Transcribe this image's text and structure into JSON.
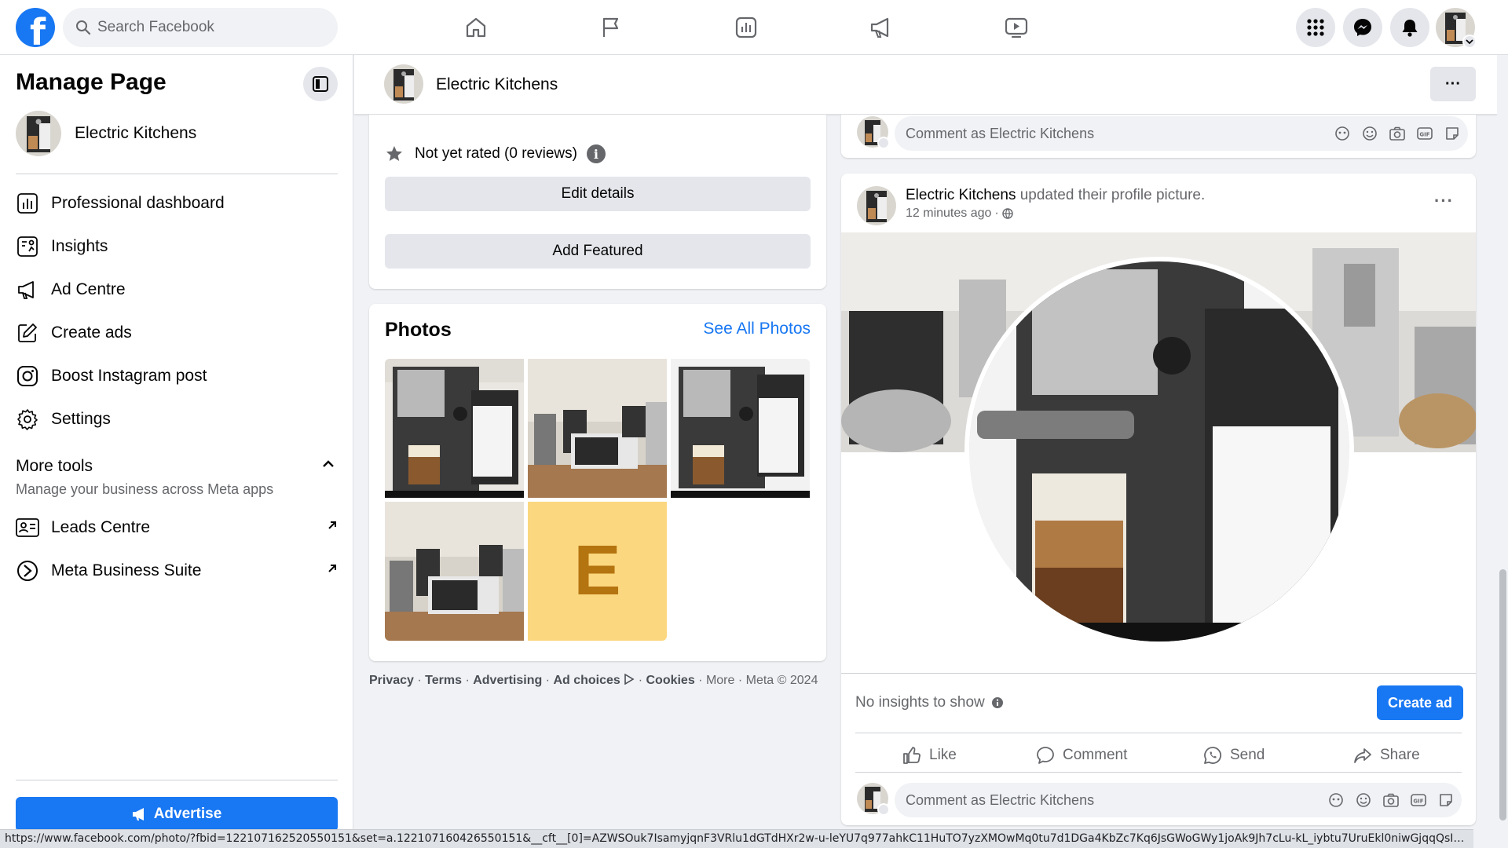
{
  "topbar": {
    "search_placeholder": "Search Facebook",
    "nav_icons": [
      "home-icon",
      "flag-icon",
      "insights-icon",
      "megaphone-icon",
      "video-icon"
    ],
    "right_icons": [
      "menu-grid-icon",
      "messenger-icon",
      "bell-icon",
      "profile-avatar"
    ]
  },
  "sidebar": {
    "title": "Manage Page",
    "page_name": "Electric Kitchens",
    "items": [
      {
        "label": "Professional dashboard",
        "icon": "dashboard-icon"
      },
      {
        "label": "Insights",
        "icon": "insights-icon"
      },
      {
        "label": "Ad Centre",
        "icon": "megaphone-icon"
      },
      {
        "label": "Create ads",
        "icon": "pencil-icon"
      },
      {
        "label": "Boost Instagram post",
        "icon": "instagram-icon"
      },
      {
        "label": "Settings",
        "icon": "gear-icon"
      }
    ],
    "more_tools": {
      "title": "More tools",
      "subtitle": "Manage your business across Meta apps",
      "items": [
        {
          "label": "Leads Centre",
          "icon": "contact-card-icon"
        },
        {
          "label": "Meta Business Suite",
          "icon": "meta-business-icon"
        }
      ]
    },
    "advertise_label": "Advertise"
  },
  "page_header": {
    "name": "Electric Kitchens",
    "more": "···"
  },
  "about_card": {
    "rating_text": "Not yet rated (0 reviews)",
    "info": "i",
    "edit_details": "Edit details",
    "add_featured": "Add Featured"
  },
  "photos_card": {
    "title": "Photos",
    "see_all": "See All Photos",
    "letter_tile": "E"
  },
  "footer": {
    "links": [
      "Privacy",
      "Terms",
      "Advertising",
      "Ad choices",
      "Cookies"
    ],
    "more": "More",
    "copyright": "Meta © 2024"
  },
  "comment_placeholder": "Comment as Electric Kitchens",
  "post": {
    "author": "Electric Kitchens",
    "action_text": "updated their profile picture.",
    "time": "12 minutes ago",
    "dots": "···",
    "insights_text": "No insights to show",
    "create_ad": "Create ad",
    "actions": [
      "Like",
      "Comment",
      "Send",
      "Share"
    ]
  },
  "status_url": "https://www.facebook.com/photo/?fbid=122107162520550151&set=a.122107160426550151&__cft__[0]=AZWSOuk7IsamyjqnF3VRlu1dGTdHXr2w-u-leYU7q977ahkC11HuTO7yzXMOwMq0tu7d1DGa4KbZc7Kq6JsGWoGWy1joAk9Jh7cLu-kL_iybtu7UruEkl0niwGjqqQsIrY4BBvqXnrWB4z...",
  "colors": {
    "brand": "#1877f2",
    "background": "#f0f2f5",
    "button_gray": "#e4e6eb",
    "letter_tile_bg": "#fbd77f",
    "letter_tile_fg": "#b4740f"
  }
}
